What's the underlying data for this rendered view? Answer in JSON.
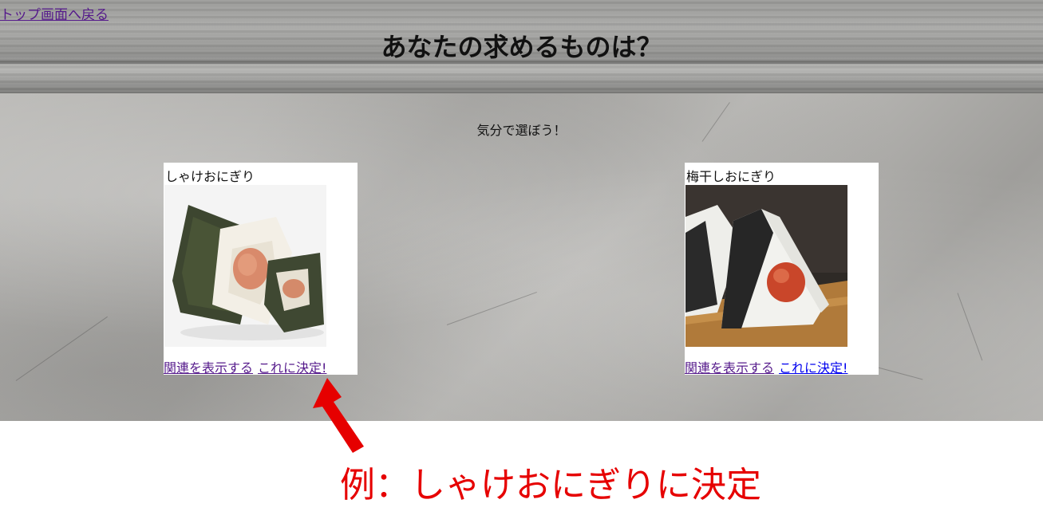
{
  "header": {
    "back_link": "トップ画面へ戻る",
    "title": "あなたの求めるものは？"
  },
  "subtitle": "気分で選ぼう！",
  "cards": [
    {
      "name": "しゃけおにぎり",
      "related_link": "関連を表示する",
      "decide_link": "これに決定!",
      "decide_color": "#551a8b"
    },
    {
      "name": "梅干しおにぎり",
      "related_link": "関連を表示する",
      "decide_link": "これに決定!",
      "decide_color": "#0000ee"
    }
  ],
  "annotation": {
    "text": "例：しゃけおにぎりに決定",
    "color": "#e60000"
  }
}
